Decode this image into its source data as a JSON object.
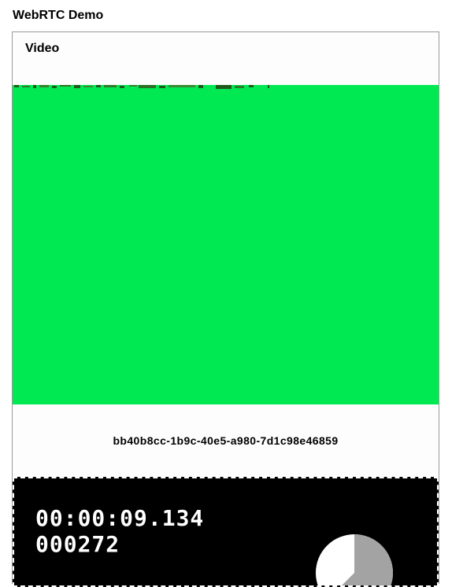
{
  "app": {
    "title": "WebRTC Demo"
  },
  "panel": {
    "title": "Video"
  },
  "video": {
    "background_color": "#00e852"
  },
  "session": {
    "id": "bb40b8cc-1b9c-40e5-a980-7d1c98e46859"
  },
  "stats": {
    "timer": "00:00:09.134",
    "frame_count": "000272"
  }
}
